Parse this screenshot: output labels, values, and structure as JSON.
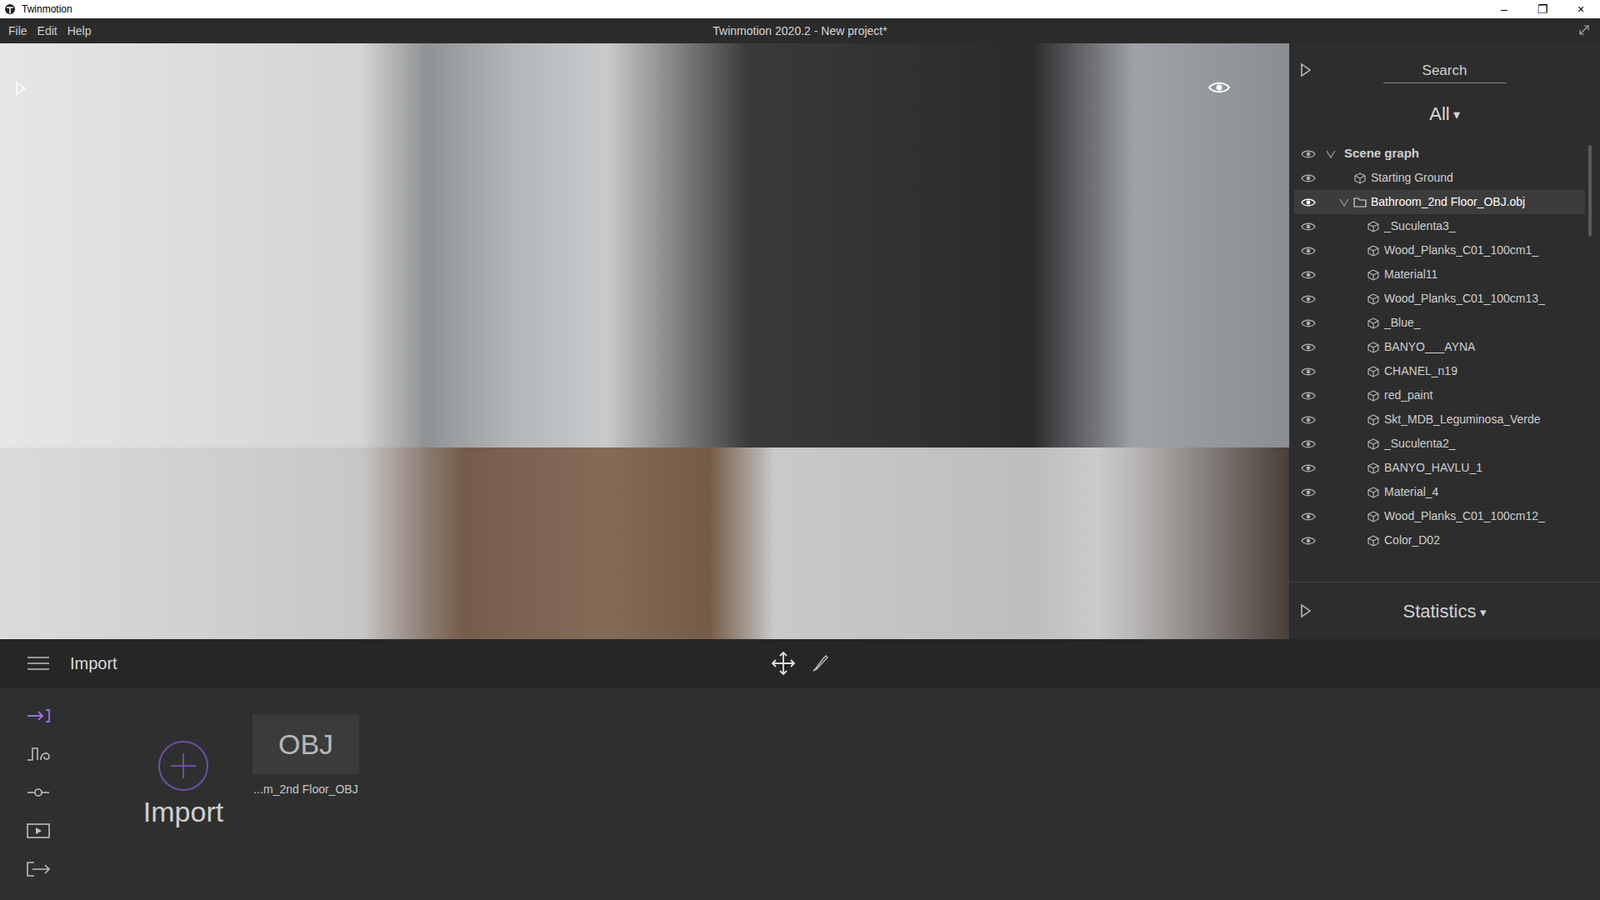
{
  "window": {
    "title": "Twinmotion",
    "controls": [
      "–",
      "❐",
      "×"
    ]
  },
  "menu": [
    "File",
    "Edit",
    "Help"
  ],
  "app_title": "Twinmotion 2020.2 - New project*",
  "panel": {
    "search": "Search",
    "filter": "All",
    "filter_arrow": "▾"
  },
  "tree": [
    {
      "label": "Scene graph",
      "level": 0,
      "kind": "group",
      "expanded": true,
      "selected": false,
      "visible": true
    },
    {
      "label": "Starting Ground",
      "level": 1,
      "kind": "object",
      "expanded": false,
      "selected": false,
      "visible": true
    },
    {
      "label": "Bathroom_2nd Floor_OBJ.obj",
      "level": 1,
      "kind": "folder",
      "expanded": true,
      "selected": true,
      "visible": true
    },
    {
      "label": "_Suculenta3_",
      "level": 2,
      "kind": "object",
      "expanded": false,
      "selected": false,
      "visible": true
    },
    {
      "label": "Wood_Planks_C01_100cm1_",
      "level": 2,
      "kind": "object",
      "expanded": false,
      "selected": false,
      "visible": true
    },
    {
      "label": "Material11",
      "level": 2,
      "kind": "object",
      "expanded": false,
      "selected": false,
      "visible": true
    },
    {
      "label": "Wood_Planks_C01_100cm13_",
      "level": 2,
      "kind": "object",
      "expanded": false,
      "selected": false,
      "visible": true
    },
    {
      "label": "_Blue_",
      "level": 2,
      "kind": "object",
      "expanded": false,
      "selected": false,
      "visible": true
    },
    {
      "label": "BANYO___AYNA",
      "level": 2,
      "kind": "object",
      "expanded": false,
      "selected": false,
      "visible": true
    },
    {
      "label": "CHANEL_n19",
      "level": 2,
      "kind": "object",
      "expanded": false,
      "selected": false,
      "visible": true
    },
    {
      "label": "red_paint",
      "level": 2,
      "kind": "object",
      "expanded": false,
      "selected": false,
      "visible": true
    },
    {
      "label": "Skt_MDB_Leguminosa_Verde",
      "level": 2,
      "kind": "object",
      "expanded": false,
      "selected": false,
      "visible": true
    },
    {
      "label": "_Suculenta2_",
      "level": 2,
      "kind": "object",
      "expanded": false,
      "selected": false,
      "visible": true
    },
    {
      "label": "BANYO_HAVLU_1",
      "level": 2,
      "kind": "object",
      "expanded": false,
      "selected": false,
      "visible": true
    },
    {
      "label": "Material_4",
      "level": 2,
      "kind": "object",
      "expanded": false,
      "selected": false,
      "visible": true
    },
    {
      "label": "Wood_Planks_C01_100cm12_",
      "level": 2,
      "kind": "object",
      "expanded": false,
      "selected": false,
      "visible": true
    },
    {
      "label": "Color_D02",
      "level": 2,
      "kind": "object",
      "expanded": false,
      "selected": false,
      "visible": true
    }
  ],
  "statistics": {
    "label": "Statistics",
    "arrow": "▾"
  },
  "toolbar": {
    "mode": "Import"
  },
  "dock_tools": [
    {
      "selected": true
    },
    {
      "selected": false
    },
    {
      "selected": false
    },
    {
      "selected": false
    },
    {
      "selected": false
    }
  ],
  "import_button": "Import",
  "imports": [
    {
      "badge": "OBJ",
      "label": "...m_2nd Floor_OBJ"
    }
  ]
}
